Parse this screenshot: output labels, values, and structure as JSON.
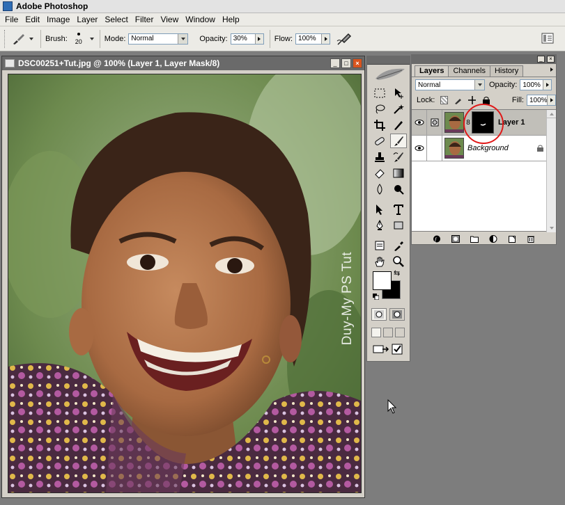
{
  "app": {
    "title": "Adobe Photoshop"
  },
  "menu": [
    "File",
    "Edit",
    "Image",
    "Layer",
    "Select",
    "Filter",
    "View",
    "Window",
    "Help"
  ],
  "options": {
    "brush_label": "Brush:",
    "brush_size": "20",
    "mode_label": "Mode:",
    "mode_value": "Normal",
    "opacity_label": "Opacity:",
    "opacity_value": "30%",
    "flow_label": "Flow:",
    "flow_value": "100%"
  },
  "document": {
    "title": "DSC00251+Tut.jpg @ 100% (Layer 1, Layer Mask/8)",
    "watermark": "Duy-My PS Tut"
  },
  "colors": {
    "foreground": "#ffffff",
    "background": "#000000",
    "highlight": "#e01818"
  },
  "layers_palette": {
    "tabs": [
      "Layers",
      "Channels",
      "History"
    ],
    "active_tab": "Layers",
    "blend_mode": "Normal",
    "opacity_label": "Opacity:",
    "opacity_value": "100%",
    "lock_label": "Lock:",
    "fill_label": "Fill:",
    "fill_value": "100%",
    "layers": [
      {
        "name": "Layer 1",
        "visible": true,
        "selected": true,
        "has_mask": true
      },
      {
        "name": "Background",
        "visible": true,
        "selected": false,
        "locked": true
      }
    ]
  }
}
